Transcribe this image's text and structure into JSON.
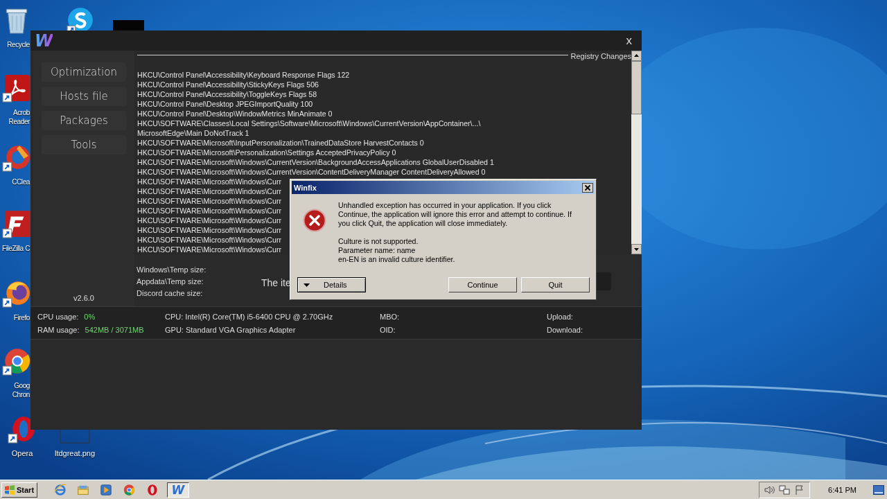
{
  "desktop": {
    "icons": [
      {
        "kind": "recycle",
        "lines": [
          "Recycle"
        ]
      },
      {
        "kind": "skype"
      },
      {
        "kind": "acrobat",
        "lines": [
          "Acrob",
          "Reader"
        ]
      },
      {
        "kind": "ccleaner",
        "lines": [
          "CClea"
        ]
      },
      {
        "kind": "filezilla",
        "lines": [
          "FileZilla C"
        ]
      },
      {
        "kind": "firefox",
        "lines": [
          "Firefo"
        ]
      },
      {
        "kind": "chrome",
        "lines": [
          "Goog",
          "Chron"
        ]
      },
      {
        "kind": "opera",
        "lines": [
          "Opera"
        ]
      },
      {
        "kind": "file",
        "lines": [
          "ltdgreat.png"
        ]
      },
      {
        "kind": "thumbnail"
      }
    ]
  },
  "app": {
    "logo": "W",
    "close": "x",
    "nav": [
      {
        "label": "Optimization"
      },
      {
        "label": "Hosts file"
      },
      {
        "label": "Packages"
      },
      {
        "label": "Tools"
      }
    ],
    "version": "v2.6.0",
    "registry": {
      "title": "Registry Changes",
      "lines": [
        "HKCU\\Control Panel\\Accessibility\\Keyboard Response Flags 122",
        "HKCU\\Control Panel\\Accessibility\\StickyKeys Flags 506",
        "HKCU\\Control Panel\\Accessibility\\ToggleKeys Flags 58",
        "HKCU\\Control Panel\\Desktop JPEGImportQuality 100",
        "HKCU\\Control Panel\\Desktop\\WindowMetrics MinAnimate 0",
        "HKCU\\SOFTWARE\\Classes\\Local Settings\\Software\\Microsoft\\Windows\\CurrentVersion\\AppContainer\\...\\",
        "MicrosoftEdge\\Main DoNotTrack 1",
        "HKCU\\SOFTWARE\\Microsoft\\InputPersonalization\\TrainedDataStore HarvestContacts 0",
        "HKCU\\SOFTWARE\\Microsoft\\Personalization\\Settings AcceptedPrivacyPolicy 0",
        "HKCU\\SOFTWARE\\Microsoft\\Windows\\CurrentVersion\\BackgroundAccessApplications GlobalUserDisabled 1",
        "HKCU\\SOFTWARE\\Microsoft\\Windows\\CurrentVersion\\ContentDeliveryManager ContentDeliveryAllowed 0",
        "HKCU\\SOFTWARE\\Microsoft\\Windows\\Curr",
        "HKCU\\SOFTWARE\\Microsoft\\Windows\\Curr",
        "HKCU\\SOFTWARE\\Microsoft\\Windows\\Curr",
        "HKCU\\SOFTWARE\\Microsoft\\Windows\\Curr",
        "HKCU\\SOFTWARE\\Microsoft\\Windows\\Curr",
        "HKCU\\SOFTWARE\\Microsoft\\Windows\\Curr",
        "HKCU\\SOFTWARE\\Microsoft\\Windows\\Curr",
        "HKCU\\SOFTWARE\\Microsoft\\Windows\\Curr"
      ]
    },
    "cleanup": {
      "labels": [
        "Windows\\Temp size:",
        "Appdata\\Temp size:",
        "Discord cache size:"
      ],
      "status": "The ite"
    },
    "stats": [
      {
        "label": "CPU usage:",
        "value": "0%"
      },
      {
        "label": "RAM usage:",
        "value": "542MB / 3071MB"
      },
      {
        "label": "CPU: Intel(R) Core(TM) i5-6400 CPU @ 2.70GHz"
      },
      {
        "label": "GPU: Standard VGA Graphics Adapter"
      },
      {
        "label": "MBO:"
      },
      {
        "label": "OID:"
      },
      {
        "label": "Upload:"
      },
      {
        "label": "Download:"
      }
    ]
  },
  "dialog": {
    "title": "Winfix",
    "message": "Unhandled exception has occurred in your application. If you click Continue, the application will ignore this error and attempt to continue. If you click Quit, the application will close immediately.",
    "details": [
      "Culture is not supported.",
      "Parameter name: name",
      "en-EN is an invalid culture identifier."
    ],
    "details_button": "Details",
    "buttons": [
      "Continue",
      "Quit"
    ]
  },
  "taskbar": {
    "start": "Start",
    "apps": [
      {
        "kind": "ie",
        "selected": false
      },
      {
        "kind": "explorer",
        "selected": false
      },
      {
        "kind": "media",
        "selected": false
      },
      {
        "kind": "chrome",
        "selected": false
      },
      {
        "kind": "opera",
        "selected": false
      },
      {
        "kind": "winfix",
        "selected": true,
        "logo": "W"
      }
    ],
    "clock": "6:41 PM"
  }
}
